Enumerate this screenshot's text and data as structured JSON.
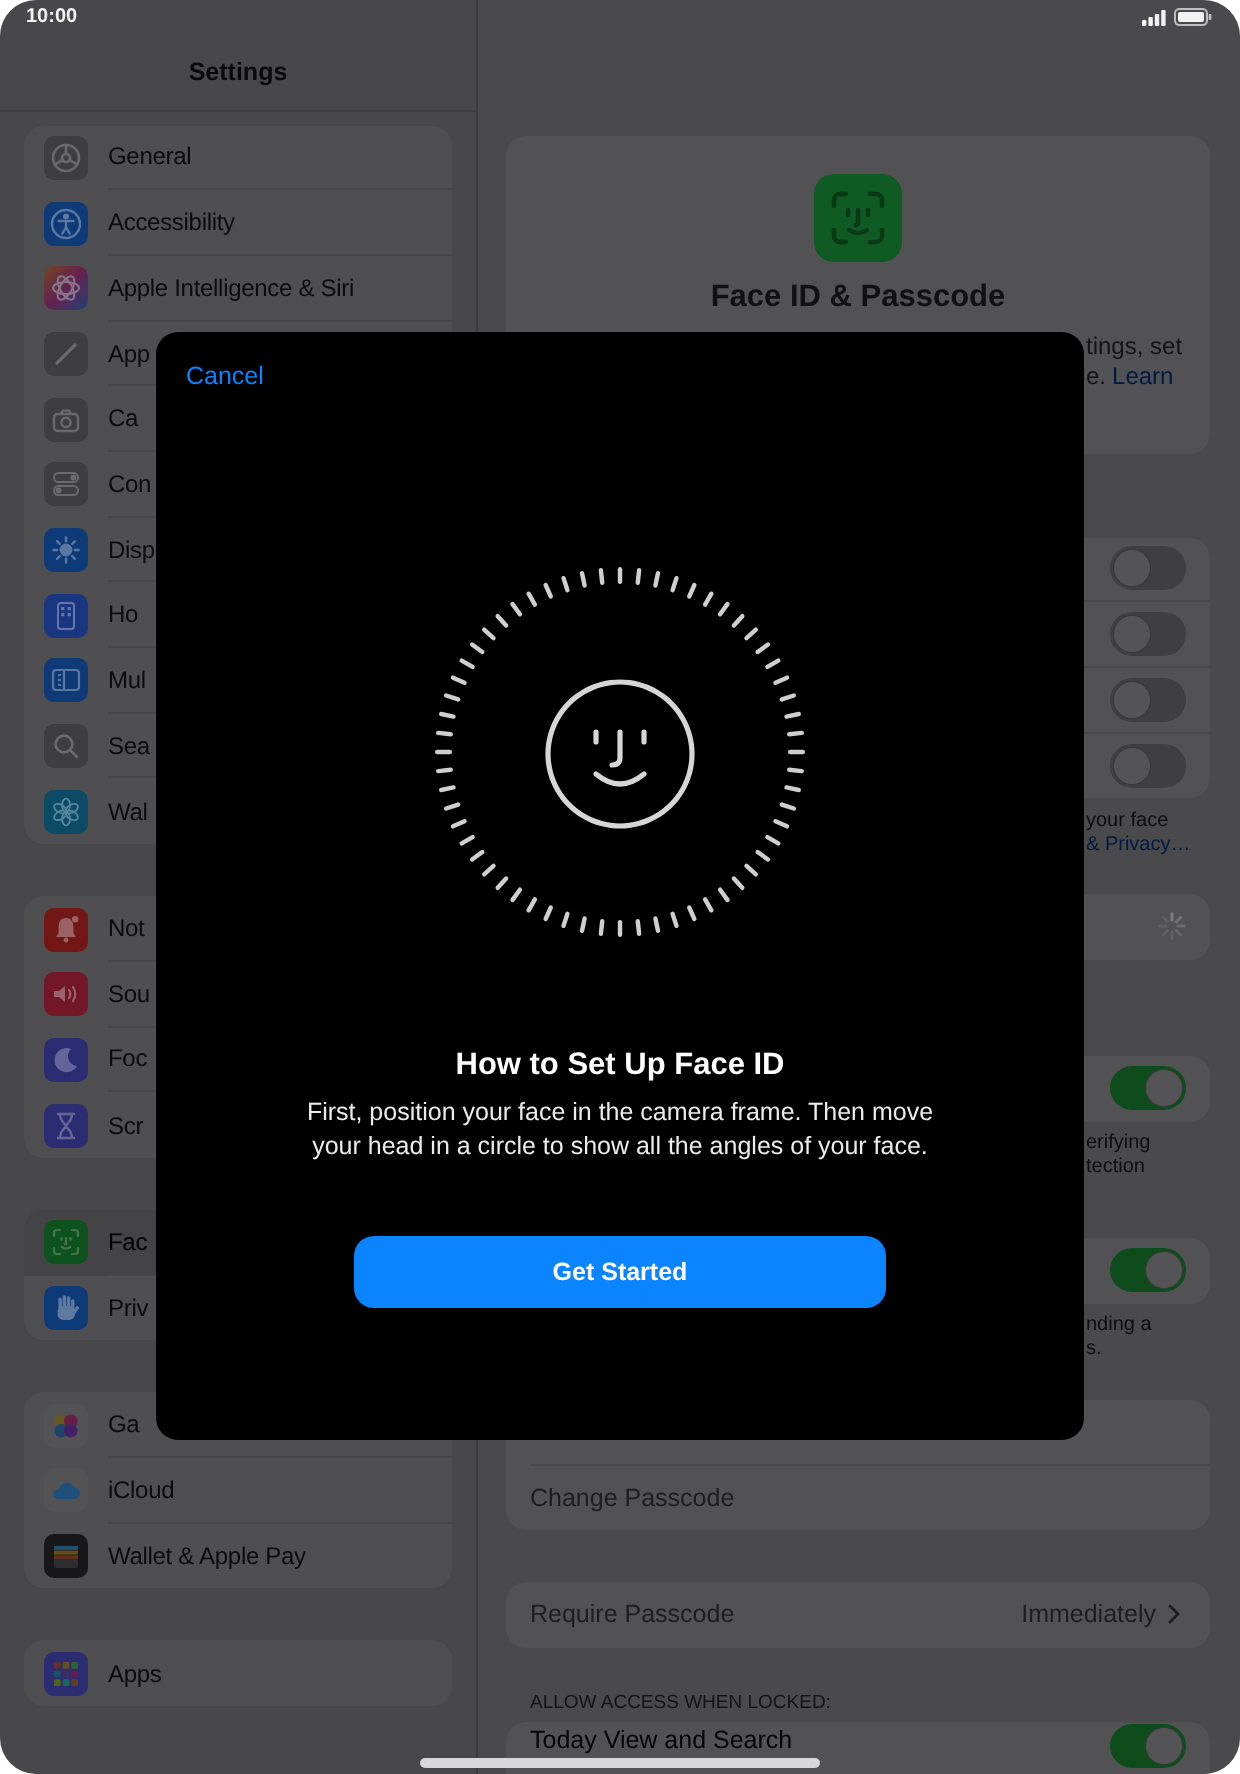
{
  "status_bar": {
    "time": "10:00"
  },
  "sidebar": {
    "title": "Settings",
    "groups": [
      {
        "items": [
          {
            "label": "General",
            "kind": "gear",
            "selected": false
          },
          {
            "label": "Accessibility",
            "kind": "accessibility",
            "selected": false
          },
          {
            "label": "Apple Intelligence & Siri",
            "kind": "swirl",
            "selected": false
          },
          {
            "label": "App",
            "kind": "pencil",
            "selected": false
          },
          {
            "label": "Ca",
            "kind": "camera",
            "selected": false
          },
          {
            "label": "Con",
            "kind": "switches",
            "selected": false
          },
          {
            "label": "Disp",
            "kind": "sun",
            "selected": false
          },
          {
            "label": "Ho",
            "kind": "homescreen",
            "selected": false
          },
          {
            "label": "Mul",
            "kind": "multitask",
            "selected": false
          },
          {
            "label": "Sea",
            "kind": "search",
            "selected": false
          },
          {
            "label": "Wal",
            "kind": "flower",
            "selected": false
          }
        ]
      },
      {
        "items": [
          {
            "label": "Not",
            "kind": "bell",
            "selected": false
          },
          {
            "label": "Sou",
            "kind": "speaker",
            "selected": false
          },
          {
            "label": "Foc",
            "kind": "moon",
            "selected": false
          },
          {
            "label": "Scr",
            "kind": "hourglass",
            "selected": false
          }
        ]
      },
      {
        "items": [
          {
            "label": "Fac",
            "kind": "faceid",
            "selected": true
          },
          {
            "label": "Priv",
            "kind": "hand",
            "selected": false
          }
        ]
      },
      {
        "items": [
          {
            "label": "Ga",
            "kind": "bubbles",
            "selected": false
          },
          {
            "label": "iCloud",
            "kind": "cloud",
            "selected": false
          },
          {
            "label": "Wallet & Apple Pay",
            "kind": "wallet",
            "selected": false
          }
        ]
      },
      {
        "items": [
          {
            "label": "Apps",
            "kind": "apps",
            "selected": false
          }
        ]
      }
    ]
  },
  "detail": {
    "header": {
      "title": "Face ID & Passcode",
      "description": [
        {
          "parts": [
            {
              "kind": "text",
              "text": "tings, set"
            }
          ]
        },
        {
          "parts": [
            {
              "kind": "text",
              "text": "e."
            },
            {
              "kind": "link",
              "text": "Learn"
            }
          ]
        }
      ]
    },
    "sections": [
      {
        "kind": "toggles",
        "rows": [
          {
            "on": false
          },
          {
            "on": false
          },
          {
            "on": false
          },
          {
            "on": false
          }
        ],
        "footer": [
          {
            "parts": [
              {
                "kind": "text",
                "text": "your face"
              }
            ]
          },
          {
            "parts": [
              {
                "kind": "link",
                "text": "& Privacy…"
              }
            ]
          }
        ]
      },
      {
        "kind": "spinner"
      },
      {
        "kind": "toggles",
        "rows": [
          {
            "on": true
          }
        ],
        "footer": [
          {
            "parts": [
              {
                "kind": "text",
                "text": "erifying"
              }
            ]
          },
          {
            "parts": [
              {
                "kind": "text",
                "text": "tection"
              }
            ]
          }
        ]
      },
      {
        "kind": "toggles",
        "rows": [
          {
            "on": true
          }
        ],
        "footer": [
          {
            "parts": [
              {
                "kind": "text",
                "text": "nding a"
              }
            ]
          },
          {
            "parts": [
              {
                "kind": "text",
                "text": "s."
              }
            ]
          }
        ]
      },
      {
        "kind": "list",
        "rows": [
          {
            "kind": "covered"
          },
          {
            "kind": "plain",
            "label": "Change Passcode",
            "disabled": true
          }
        ]
      },
      {
        "kind": "list",
        "rows": [
          {
            "kind": "value",
            "label": "Require Passcode",
            "value": "Immediately",
            "disabled": true
          }
        ]
      },
      {
        "kind": "list",
        "header": "ALLOW ACCESS WHEN LOCKED:",
        "rows": [
          {
            "kind": "toggle",
            "label": "Today View and Search",
            "on": true
          }
        ]
      }
    ]
  },
  "dialog": {
    "cancel": "Cancel",
    "title": "How to Set Up Face ID",
    "body": "First, position your face in the camera frame. Then move your head in a circle to show all the angles of your face.",
    "button": "Get Started"
  }
}
